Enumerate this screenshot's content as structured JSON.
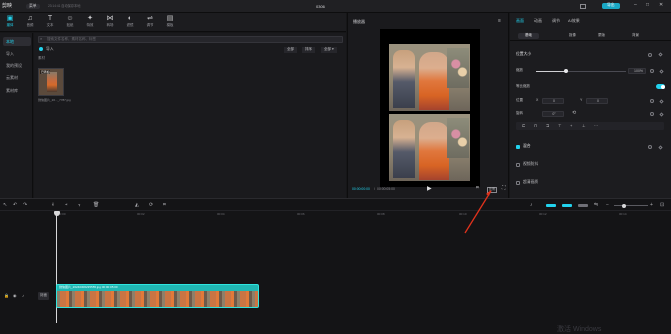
{
  "app": {
    "logo": "剪映",
    "menu": "菜单",
    "autosave": "23:14:41 自动保存本地",
    "title": "0306",
    "right_btn": "导出"
  },
  "toolbar": {
    "items": [
      {
        "label": "媒体",
        "icon": "▣"
      },
      {
        "label": "音频",
        "icon": "♫"
      },
      {
        "label": "文本",
        "icon": "T"
      },
      {
        "label": "贴纸",
        "icon": "☺"
      },
      {
        "label": "特效",
        "icon": "✦"
      },
      {
        "label": "转场",
        "icon": "⋈"
      },
      {
        "label": "滤镜",
        "icon": "◐"
      },
      {
        "label": "调节",
        "icon": "⇌"
      },
      {
        "label": "模板",
        "icon": "▤"
      }
    ]
  },
  "sidenav": {
    "items": [
      "本地",
      "导入",
      "我的预设",
      "云素材",
      "素材库"
    ]
  },
  "media": {
    "search_placeholder": "搜索文件名称、素材名称、标签",
    "import_label": "导入",
    "section": "素材",
    "sort": "排序",
    "filter": "全部",
    "thumb_badge": "已添加",
    "thumb_caption": "微信图片_20..._7787.jpg"
  },
  "player": {
    "title": "播放器",
    "time_current": "00:00:00:00",
    "time_total": "00:00:05:00",
    "ratio": "比例",
    "fullscreen": "⛶"
  },
  "props": {
    "tabs": [
      "画面",
      "动画",
      "调节",
      "AI效果"
    ],
    "subtabs": [
      "基础",
      "抠像",
      "蒙版",
      "背景"
    ],
    "section_position": "位置大小",
    "scale_label": "缩放",
    "scale_value": "100%",
    "uniform_label": "等比缩放",
    "position_label": "位置",
    "pos_x_label": "X",
    "pos_x": "0",
    "pos_y_label": "Y",
    "pos_y": "0",
    "rotation_label": "旋转",
    "rotation_value": "0°",
    "section_mix": "混合",
    "section_stabilize": "视频防抖",
    "section_enhance": "超清画质"
  },
  "timeline": {
    "ticks": [
      "00:00",
      "00:02",
      "00:04",
      "00:06",
      "00:08",
      "00:10",
      "00:12",
      "00:14"
    ],
    "clip_label": "微信图片_20240306235555.jpg   00:00:05:00",
    "track_label": "封面"
  },
  "colors": {
    "accent": "#22d3ee",
    "clip": "#20b7b3",
    "bg": "#161618",
    "panel": "#1a1a1d",
    "annotation": "#e0321c"
  },
  "watermark": "激活 Windows"
}
